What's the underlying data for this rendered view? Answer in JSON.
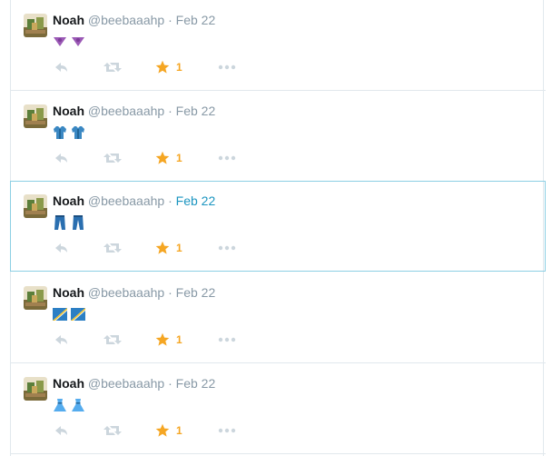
{
  "tweets": [
    {
      "name": "Noah",
      "handle": "@beebaaahp",
      "separator": "·",
      "time": "Feb 22",
      "emoji": "bikini",
      "likes": "1",
      "selected": false
    },
    {
      "name": "Noah",
      "handle": "@beebaaahp",
      "separator": "·",
      "time": "Feb 22",
      "emoji": "shirt",
      "likes": "1",
      "selected": false
    },
    {
      "name": "Noah",
      "handle": "@beebaaahp",
      "separator": "·",
      "time": "Feb 22",
      "emoji": "jeans",
      "likes": "1",
      "selected": true
    },
    {
      "name": "Noah",
      "handle": "@beebaaahp",
      "separator": "·",
      "time": "Feb 22",
      "emoji": "flag",
      "likes": "1",
      "selected": false
    },
    {
      "name": "Noah",
      "handle": "@beebaaahp",
      "separator": "·",
      "time": "Feb 22",
      "emoji": "dress",
      "likes": "1",
      "selected": false
    }
  ],
  "colors": {
    "like": "#f5a623",
    "action_icon": "#ccd6dd",
    "link_blue": "#1b95c0",
    "border": "#e1e8ed",
    "selected_border": "#8ccfe4"
  },
  "icons": [
    "avatar-icon",
    "reply-icon",
    "retweet-icon",
    "star-icon",
    "more-icon"
  ]
}
